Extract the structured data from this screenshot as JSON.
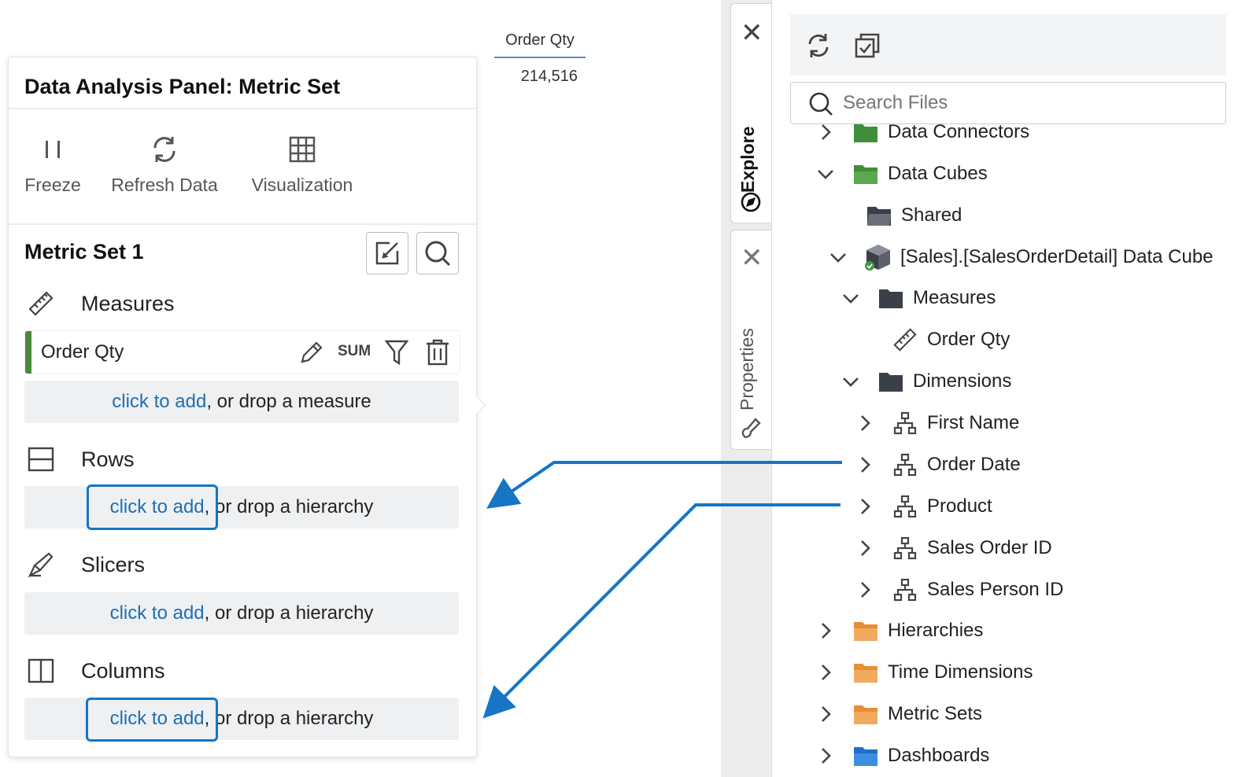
{
  "panel": {
    "title": "Data Analysis Panel: Metric Set",
    "toolbar": {
      "freeze": "Freeze",
      "refresh": "Refresh Data",
      "visualization": "Visualization"
    },
    "metric_set_title": "Metric Set 1",
    "measures": {
      "label": "Measures",
      "items": [
        {
          "name": "Order Qty",
          "aggregate": "SUM",
          "color": "#4a8a3c"
        }
      ],
      "add_link": "click to add",
      "add_suffix": ", or drop a measure"
    },
    "rows": {
      "label": "Rows",
      "add_link": "click to add",
      "add_suffix": ", or drop a hierarchy"
    },
    "slicers": {
      "label": "Slicers",
      "add_link": "click to add",
      "add_suffix": ", or drop a hierarchy"
    },
    "columns": {
      "label": "Columns",
      "add_link": "click to add",
      "add_suffix": ", or drop a hierarchy"
    }
  },
  "table": {
    "header": "Order Qty",
    "value": "214,516"
  },
  "side_tabs": {
    "explore": "Explore",
    "properties": "Properties"
  },
  "explorer": {
    "search_placeholder": "Search Files",
    "tree": [
      {
        "label": "Data Connectors",
        "icon": "folder-green-icon",
        "state": "collapsed"
      },
      {
        "label": "Data Cubes",
        "icon": "folder-green-icon",
        "state": "expanded"
      },
      {
        "label": "Shared",
        "icon": "folder-open-gray-icon"
      },
      {
        "label": "[Sales].[SalesOrderDetail] Data Cube",
        "icon": "data-cube-icon",
        "state": "expanded"
      },
      {
        "label": "Measures",
        "icon": "folder-dark-icon",
        "state": "expanded"
      },
      {
        "label": "Order Qty",
        "icon": "ruler-icon"
      },
      {
        "label": "Dimensions",
        "icon": "folder-dark-icon",
        "state": "expanded"
      },
      {
        "label": "First Name",
        "icon": "hierarchy-icon",
        "state": "collapsed"
      },
      {
        "label": "Order Date",
        "icon": "hierarchy-icon",
        "state": "collapsed"
      },
      {
        "label": "Product",
        "icon": "hierarchy-icon",
        "state": "collapsed"
      },
      {
        "label": "Sales Order ID",
        "icon": "hierarchy-icon",
        "state": "collapsed"
      },
      {
        "label": "Sales Person ID",
        "icon": "hierarchy-icon",
        "state": "collapsed"
      },
      {
        "label": "Hierarchies",
        "icon": "folder-orange-icon",
        "state": "collapsed"
      },
      {
        "label": "Time Dimensions",
        "icon": "folder-orange-icon",
        "state": "collapsed"
      },
      {
        "label": "Metric Sets",
        "icon": "folder-orange-icon",
        "state": "collapsed"
      },
      {
        "label": "Dashboards",
        "icon": "folder-blue-icon",
        "state": "collapsed"
      }
    ]
  },
  "colors": {
    "accent": "#1675c4",
    "link": "#1f6fb2",
    "folder_green": "#3f8f3a",
    "folder_orange": "#f0a04b",
    "folder_blue": "#2c7fd6"
  }
}
